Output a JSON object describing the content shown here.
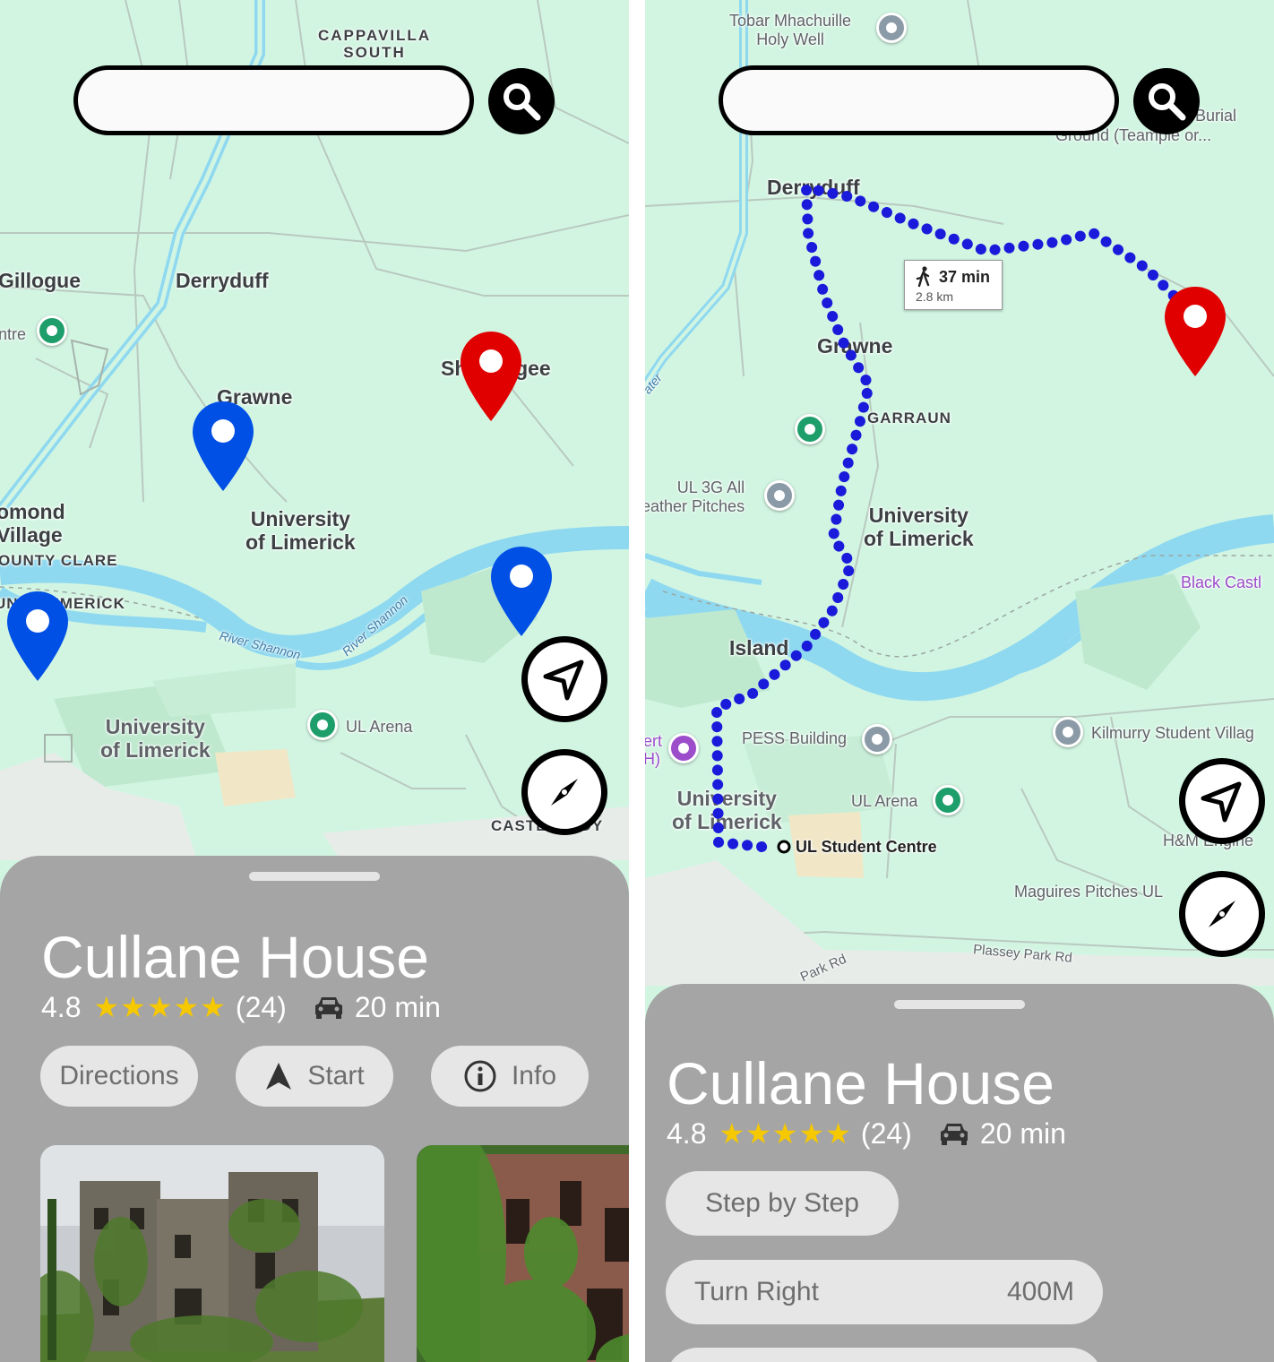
{
  "left": {
    "search": {
      "value": "",
      "placeholder": ""
    },
    "map_labels": {
      "cappavilla": "CAPPAVILLA\nSOUTH",
      "gillogue": "Gillogue",
      "derryduff": "Derryduff",
      "centre_partial": "ntre",
      "shanvoge": "Shanvogee",
      "grawne": "Grawne",
      "thomond": "omond\nVillage",
      "univ_upper": "University\nof Limerick",
      "county_clare": "OUNTY CLARE",
      "limerick_county": "UNTY LIMERICK",
      "river_shannon_1": "River Shannon",
      "river_shannon_2": "River Shannon",
      "univ_lower": "University\nof Limerick",
      "ul_arena": "UL Arena",
      "castletroy_partial": "CASTLETROY"
    },
    "pins": [
      {
        "name": "destination-pin",
        "color": "#e00000"
      },
      {
        "name": "location-pin-1",
        "color": "#0050e6"
      },
      {
        "name": "location-pin-2",
        "color": "#0050e6"
      },
      {
        "name": "location-pin-3",
        "color": "#0050e6"
      }
    ],
    "sheet": {
      "title": "Cullane House",
      "rating": "4.8",
      "stars": "★★★★★",
      "reviews": "(24)",
      "travel_time": "20 min",
      "buttons": {
        "directions": "Directions",
        "start": "Start",
        "info": "Info"
      }
    }
  },
  "right": {
    "search": {
      "value": "",
      "placeholder": ""
    },
    "map_labels": {
      "tobar": "Tobar Mhachuille\nHoly Well",
      "burial": "Burial",
      "ground": "Ground (Teampie or...",
      "derryduff": "Derryduff",
      "grawne": "Grawne",
      "garraun": "GARRAUN",
      "ul3g": "UL 3G All\neather Pitches",
      "univ": "University\nof Limerick",
      "black_castle": "Black Castl",
      "water": "ater",
      "island": "Island",
      "ert": "ert\nH)",
      "pess": "PESS Building",
      "kilmurry": "Kilmurry Student Villag",
      "univ_lower": "University\nof Limerick",
      "ul_arena": "UL Arena",
      "student_centre": "UL Student Centre",
      "hm": "H&M Engine",
      "maguires": "Maguires Pitches UL",
      "plassey1": "Plassey Park Rd",
      "plassey2": "Park Rd"
    },
    "route_info": {
      "time": "37 min",
      "distance": "2.8 km",
      "mode_icon": "walking-person-icon"
    },
    "sheet": {
      "title": "Cullane House",
      "rating": "4.8",
      "stars": "★★★★★",
      "reviews": "(24)",
      "travel_time": "20 min",
      "step_by_step": "Step by Step",
      "steps": [
        {
          "instruction": "Turn Right",
          "distance": "400M"
        }
      ]
    }
  },
  "colors": {
    "map_background": "#d2f5e2",
    "river": "#8fd9f0",
    "route": "#1a1adb",
    "sheet": "#a5a5a5",
    "pin_red": "#e00000",
    "pin_blue": "#0050e6",
    "star": "#f5c800"
  }
}
